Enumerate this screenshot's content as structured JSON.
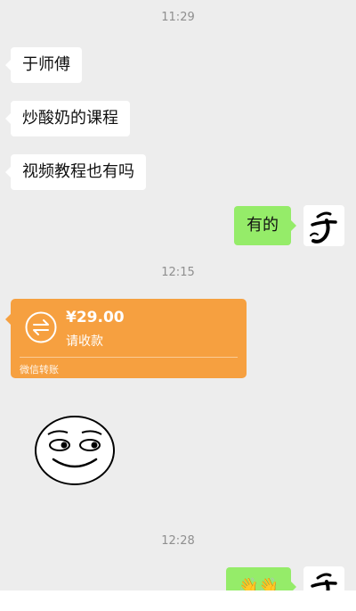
{
  "timestamps": [
    "11:29",
    "12:15",
    "12:28"
  ],
  "messages": {
    "m1": "于师傅",
    "m2": "炒酸奶的课程",
    "m3": "视频教程也有吗",
    "r1": "有的",
    "r2_emoji": "👋👋"
  },
  "transfer": {
    "amount": "¥29.00",
    "status": "请收款",
    "footer": "微信转账",
    "icon": "transfer-arrows-icon"
  },
  "colors": {
    "background": "#ededed",
    "bubble_left": "#ffffff",
    "bubble_right": "#95ec69",
    "transfer": "#f6a040",
    "timestamp": "#8f8f8f"
  }
}
